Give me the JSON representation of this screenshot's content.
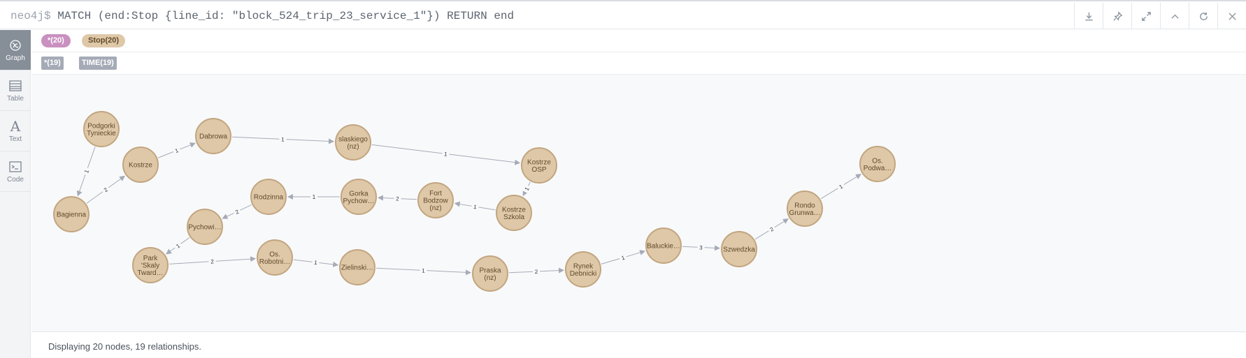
{
  "query": {
    "prompt": "neo4j$",
    "text": "MATCH (end:Stop {line_id: \"block_524_trip_23_service_1\"}) RETURN end"
  },
  "toolbar": {
    "icons": [
      "download-icon",
      "pin-icon",
      "expand-icon",
      "collapse-up-icon",
      "refresh-icon",
      "close-icon"
    ]
  },
  "sidebar": {
    "items": [
      {
        "label": "Graph",
        "icon": "graph-icon",
        "active": true
      },
      {
        "label": "Table",
        "icon": "table-icon",
        "active": false
      },
      {
        "label": "Text",
        "icon": "text-icon",
        "active": false
      },
      {
        "label": "Code",
        "icon": "code-icon",
        "active": false
      }
    ]
  },
  "legend": {
    "labels": [
      {
        "text": "*(20)",
        "color": "#c990c0"
      },
      {
        "text": "Stop(20)",
        "color": "#dec8a8"
      }
    ],
    "relationships": [
      {
        "text": "*(19)",
        "color": "#a5abb6"
      },
      {
        "text": "TIME(19)",
        "color": "#a5abb6"
      }
    ]
  },
  "graph": {
    "node_color": "#dec8a8",
    "edge_color": "#a5abb6",
    "nodes": [
      {
        "id": "podgorki",
        "lines": [
          "Podgorki",
          "Tynieckie"
        ]
      },
      {
        "id": "bagienna",
        "lines": [
          "Bagienna"
        ]
      },
      {
        "id": "kostrze",
        "lines": [
          "Kostrze"
        ]
      },
      {
        "id": "dabrowa",
        "lines": [
          "Dabrowa"
        ]
      },
      {
        "id": "slaskiego",
        "lines": [
          "slaskiego",
          "(nz)"
        ]
      },
      {
        "id": "kostrze_osp",
        "lines": [
          "Kostrze",
          "OSP"
        ]
      },
      {
        "id": "kostrze_szkola",
        "lines": [
          "Kostrze",
          "Szkola"
        ]
      },
      {
        "id": "fort_bodzow",
        "lines": [
          "Fort",
          "Bodzow",
          "(nz)"
        ]
      },
      {
        "id": "gorka",
        "lines": [
          "Gorka",
          "Pychow…"
        ]
      },
      {
        "id": "rodzinna",
        "lines": [
          "Rodzinna"
        ]
      },
      {
        "id": "pychowi",
        "lines": [
          "Pychowi…"
        ]
      },
      {
        "id": "park",
        "lines": [
          "Park",
          "'Skaly",
          "Tward…"
        ]
      },
      {
        "id": "os_robotn",
        "lines": [
          "Os.",
          "Robotni…"
        ]
      },
      {
        "id": "zielinski",
        "lines": [
          "Zielinski…"
        ]
      },
      {
        "id": "praska",
        "lines": [
          "Praska",
          "(nz)"
        ]
      },
      {
        "id": "rynek",
        "lines": [
          "Rynek",
          "Debnicki"
        ]
      },
      {
        "id": "baluckie",
        "lines": [
          "Baluckie…"
        ]
      },
      {
        "id": "szwedzka",
        "lines": [
          "Szwedzka"
        ]
      },
      {
        "id": "rondo",
        "lines": [
          "Rondo",
          "Grunwa…"
        ]
      },
      {
        "id": "os_podwa",
        "lines": [
          "Os.",
          "Podwa…"
        ]
      }
    ],
    "edges": [
      {
        "from": "podgorki",
        "to": "bagienna",
        "label": "1"
      },
      {
        "from": "bagienna",
        "to": "kostrze",
        "label": "2"
      },
      {
        "from": "kostrze",
        "to": "dabrowa",
        "label": "1"
      },
      {
        "from": "dabrowa",
        "to": "slaskiego",
        "label": "1"
      },
      {
        "from": "slaskiego",
        "to": "kostrze_osp",
        "label": "1"
      },
      {
        "from": "kostrze_osp",
        "to": "kostrze_szkola",
        "label": "1"
      },
      {
        "from": "kostrze_szkola",
        "to": "fort_bodzow",
        "label": "1"
      },
      {
        "from": "fort_bodzow",
        "to": "gorka",
        "label": "2"
      },
      {
        "from": "gorka",
        "to": "rodzinna",
        "label": "1"
      },
      {
        "from": "rodzinna",
        "to": "pychowi",
        "label": "2"
      },
      {
        "from": "pychowi",
        "to": "park",
        "label": "1"
      },
      {
        "from": "park",
        "to": "os_robotn",
        "label": "2"
      },
      {
        "from": "os_robotn",
        "to": "zielinski",
        "label": "1"
      },
      {
        "from": "zielinski",
        "to": "praska",
        "label": "1"
      },
      {
        "from": "praska",
        "to": "rynek",
        "label": "2"
      },
      {
        "from": "rynek",
        "to": "baluckie",
        "label": "1"
      },
      {
        "from": "baluckie",
        "to": "szwedzka",
        "label": "3"
      },
      {
        "from": "szwedzka",
        "to": "rondo",
        "label": "2"
      },
      {
        "from": "rondo",
        "to": "os_podwa",
        "label": "1"
      }
    ]
  },
  "status": {
    "text": "Displaying 20 nodes, 19 relationships."
  }
}
